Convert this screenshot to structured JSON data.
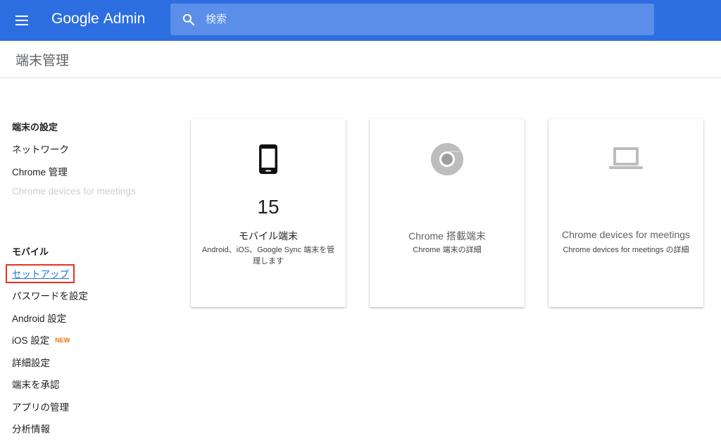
{
  "header": {
    "logo_brand": "Google",
    "logo_product": "Admin",
    "search_placeholder": "検索"
  },
  "page": {
    "title": "端末管理"
  },
  "sidebar": {
    "sections": [
      {
        "heading": "端末の設定",
        "items": [
          {
            "label": "ネットワーク"
          },
          {
            "label": "Chrome 管理"
          },
          {
            "label": "Chrome devices for meetings",
            "disabled": true
          }
        ]
      },
      {
        "heading": "モバイル",
        "items": [
          {
            "label": "セットアップ",
            "highlighted": true
          },
          {
            "label": "パスワードを設定"
          },
          {
            "label": "Android 設定"
          },
          {
            "label": "iOS 設定",
            "badge": "NEW"
          },
          {
            "label": "詳細設定"
          },
          {
            "label": "端末を承認"
          },
          {
            "label": "アプリの管理"
          },
          {
            "label": "分析情報"
          }
        ]
      }
    ]
  },
  "cards": [
    {
      "icon": "smartphone-icon",
      "count": "15",
      "title": "モバイル端末",
      "description": "Android、iOS、Google Sync 端末を管理します"
    },
    {
      "icon": "chrome-icon",
      "title": "Chrome 搭載端末",
      "description": "Chrome 端末の詳細"
    },
    {
      "icon": "laptop-icon",
      "title": "Chrome devices for meetings",
      "description": "Chrome devices for meetings の詳細"
    }
  ],
  "colors": {
    "header_bg": "#2c6ee0",
    "search_bg": "#5a8ee8",
    "highlight_border": "#e8321e",
    "link": "#1a73e8",
    "badge_new": "#e8710a"
  }
}
